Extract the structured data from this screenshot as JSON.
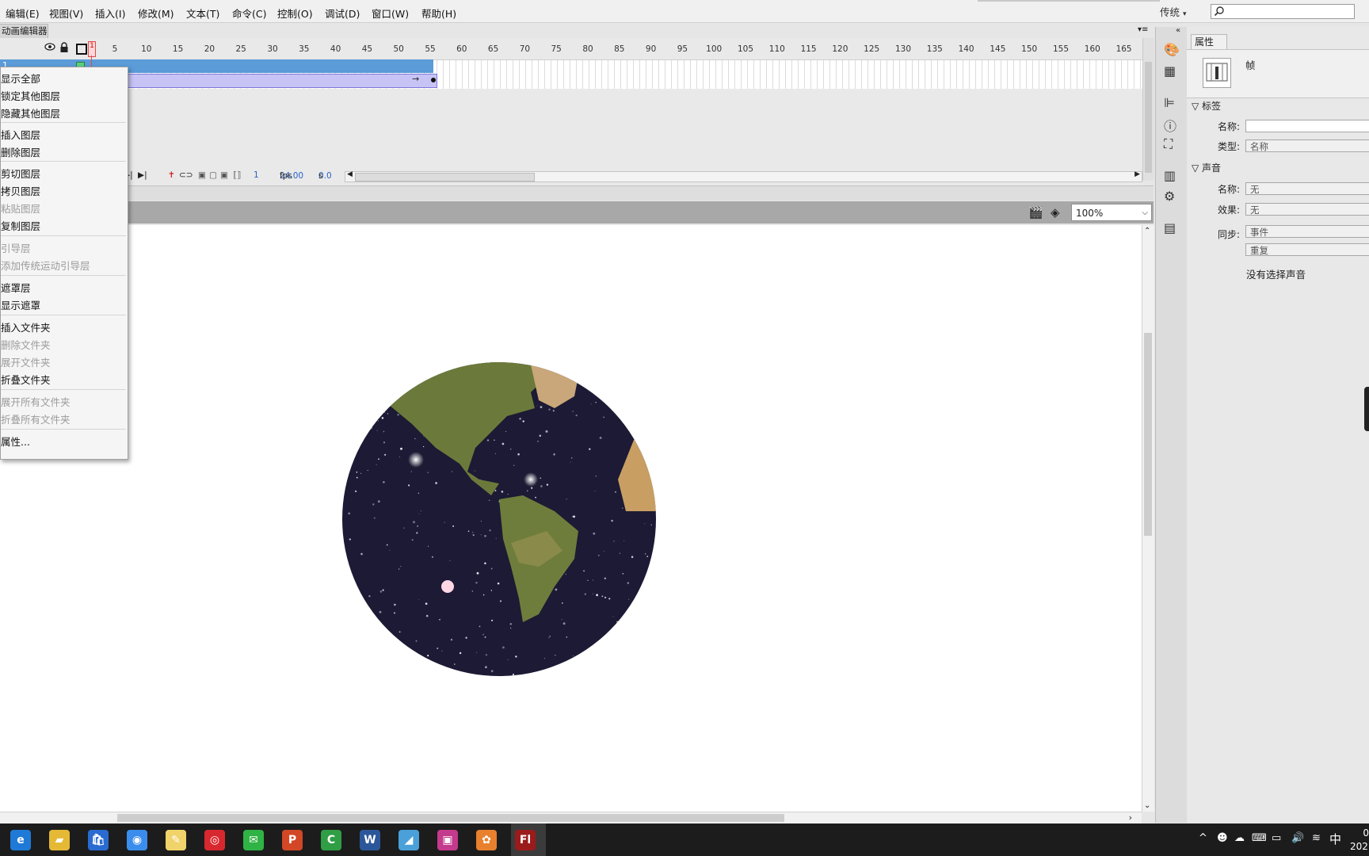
{
  "menubar": {
    "items": [
      "编辑(E)",
      "视图(V)",
      "插入(I)",
      "修改(M)",
      "文本(T)",
      "命令(C)",
      "控制(O)",
      "调试(D)",
      "窗口(W)",
      "帮助(H)"
    ],
    "workspace": "传统",
    "workspace_chevron": "▾"
  },
  "timeline": {
    "tab_label": "动画编辑器",
    "ruler_labels": [
      "5",
      "10",
      "15",
      "20",
      "25",
      "30",
      "35",
      "40",
      "45",
      "50",
      "55",
      "60",
      "65",
      "70",
      "75",
      "80",
      "85",
      "90",
      "95",
      "100",
      "105",
      "110",
      "115",
      "120",
      "125",
      "130",
      "135",
      "140",
      "145",
      "150",
      "155",
      "160",
      "165"
    ],
    "current_frame_marker": "1",
    "layer_number": "1",
    "current_frame": "1",
    "fps": "24.00",
    "fps_unit": "fps",
    "time": "0.0",
    "time_unit": "s"
  },
  "stage": {
    "zoom": "100%"
  },
  "context_menu": {
    "items": [
      {
        "label": "显示全部",
        "enabled": true
      },
      {
        "label": "锁定其他图层",
        "enabled": true
      },
      {
        "label": "隐藏其他图层",
        "enabled": true
      },
      {
        "label": "插入图层",
        "enabled": true
      },
      {
        "label": "删除图层",
        "enabled": true
      },
      {
        "label": "剪切图层",
        "enabled": true
      },
      {
        "label": "拷贝图层",
        "enabled": true
      },
      {
        "label": "粘贴图层",
        "enabled": false
      },
      {
        "label": "复制图层",
        "enabled": true
      },
      {
        "label": "引导层",
        "enabled": false
      },
      {
        "label": "添加传统运动引导层",
        "enabled": false
      },
      {
        "label": "遮罩层",
        "enabled": true
      },
      {
        "label": "显示遮罩",
        "enabled": true
      },
      {
        "label": "插入文件夹",
        "enabled": true
      },
      {
        "label": "删除文件夹",
        "enabled": false
      },
      {
        "label": "展开文件夹",
        "enabled": false
      },
      {
        "label": "折叠文件夹",
        "enabled": true
      },
      {
        "label": "展开所有文件夹",
        "enabled": false
      },
      {
        "label": "折叠所有文件夹",
        "enabled": false
      },
      {
        "label": "属性...",
        "enabled": true
      }
    ]
  },
  "properties": {
    "tab_label": "属性",
    "object_type": "帧",
    "label_section": "标签",
    "name_label": "名称:",
    "name_value": "",
    "type_label": "类型:",
    "type_value": "名称",
    "sound_section": "声音",
    "sound_name_label": "名称:",
    "sound_name_value": "无",
    "effect_label": "效果:",
    "effect_value": "无",
    "sync_label": "同步:",
    "sync_value": "事件",
    "repeat_value": "重复",
    "no_sound_text": "没有选择声音"
  },
  "taskbar": {
    "apps": [
      "edge-icon",
      "file-explorer-icon",
      "store-icon",
      "chrome-icon",
      "notes-icon",
      "netease-music-icon",
      "wechat-icon",
      "powerpoint-icon",
      "camtasia-icon",
      "word-icon",
      "edit-tool-icon",
      "color-tool-icon",
      "flower-app-icon",
      "flash-icon"
    ],
    "ime": "中",
    "clock_time": "0",
    "clock_date": "202"
  },
  "colors": {
    "timeline_layer_blue": "#5a9bd8",
    "tween_purple": "#c7c3f5",
    "playhead_red": "#e14a4a",
    "taskbar": "#1c1c1c"
  }
}
